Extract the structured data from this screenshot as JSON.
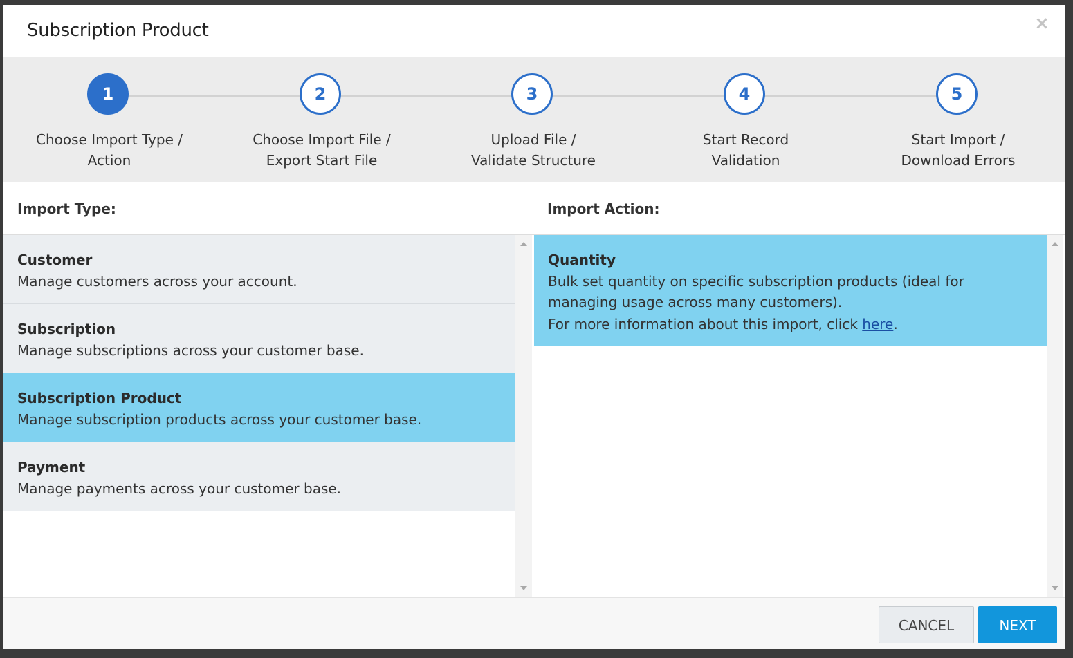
{
  "modal": {
    "title": "Subscription Product",
    "close_symbol": "×"
  },
  "stepper": {
    "steps": [
      {
        "number": "1",
        "label": "Choose Import Type /\nAction",
        "active": true
      },
      {
        "number": "2",
        "label": "Choose Import File /\nExport Start File",
        "active": false
      },
      {
        "number": "3",
        "label": "Upload File /\nValidate Structure",
        "active": false
      },
      {
        "number": "4",
        "label": "Start Record\nValidation",
        "active": false
      },
      {
        "number": "5",
        "label": "Start Import /\nDownload Errors",
        "active": false
      }
    ]
  },
  "import_type": {
    "heading": "Import Type:",
    "items": [
      {
        "title": "Customer",
        "description": "Manage customers across your account.",
        "selected": false
      },
      {
        "title": "Subscription",
        "description": "Manage subscriptions across your customer base.",
        "selected": false
      },
      {
        "title": "Subscription Product",
        "description": "Manage subscription products across your customer base.",
        "selected": true
      },
      {
        "title": "Payment",
        "description": "Manage payments across your customer base.",
        "selected": false
      }
    ]
  },
  "import_action": {
    "heading": "Import Action:",
    "items": [
      {
        "title": "Quantity",
        "description": "Bulk set quantity on specific subscription products (ideal for managing usage across many customers).",
        "info_prefix": "For more information about this import, click ",
        "info_link": "here",
        "info_suffix": ".",
        "selected": true
      }
    ]
  },
  "footer": {
    "cancel_label": "CANCEL",
    "next_label": "NEXT"
  },
  "colors": {
    "accent": "#2c6fca",
    "selected_row": "#80d2f0",
    "primary_button": "#1296dc"
  }
}
